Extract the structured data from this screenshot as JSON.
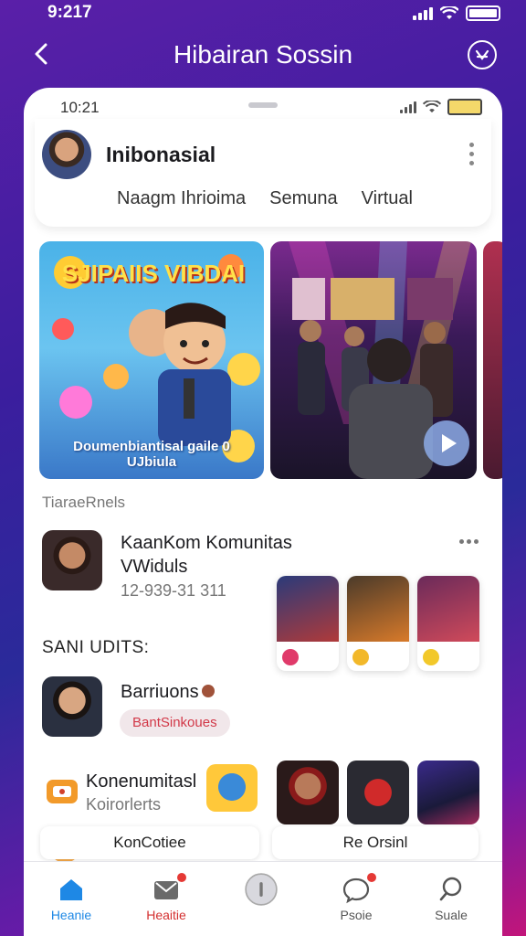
{
  "device": {
    "time": "9:217",
    "inner_time": "10:21"
  },
  "header": {
    "title": "Hibairan Sossin",
    "back_icon": "chevron-left-icon",
    "action_icon": "badge-icon"
  },
  "profile": {
    "name": "Inibonasial"
  },
  "tabs": [
    {
      "label": "Naagm Ihrioima"
    },
    {
      "label": "Semuna"
    },
    {
      "label": "Virtual"
    }
  ],
  "carousel": [
    {
      "title": "SJIPAIIS VIBDAI",
      "subtitle": "Doumenbiantisal gaile 0 UJbiula"
    },
    {
      "title": "",
      "subtitle": ""
    }
  ],
  "sections": {
    "first_label": "TiaraeRnels",
    "second_label": "SANI UDITS:"
  },
  "community": {
    "title_line1": "KaanKom Komunitas",
    "title_line2": "VWiduls",
    "meta": "12-939-31 311"
  },
  "artist": {
    "name": "Barriuons",
    "tag": "BantSinkoues"
  },
  "third_row": {
    "title": "Konenumitasl",
    "subtitle": "Koirorlerts"
  },
  "bottom_pills": [
    {
      "label": "KonCotiee"
    },
    {
      "label": "Re Orsinl"
    }
  ],
  "nav": [
    {
      "label": "Heanie",
      "icon": "home-icon",
      "color": "#1e88e5"
    },
    {
      "label": "Heaitie",
      "icon": "message-icon",
      "color": "#d32f2f"
    },
    {
      "label": "",
      "icon": "center-icon",
      "color": "#666666"
    },
    {
      "label": "Psoie",
      "icon": "chat-icon",
      "color": "#555555"
    },
    {
      "label": "Suale",
      "icon": "search-icon",
      "color": "#555555"
    }
  ],
  "colors": {
    "accent": "#d23848",
    "brand_gradient_start": "#5a1fa8",
    "brand_gradient_end": "#c2157a"
  }
}
